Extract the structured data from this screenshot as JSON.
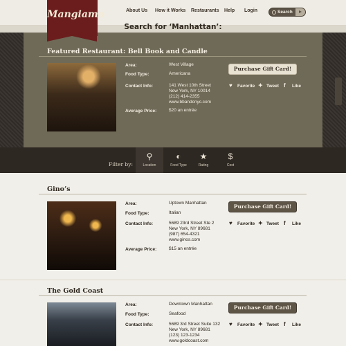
{
  "logo": "Mangiamo",
  "nav": {
    "items": [
      "About Us",
      "How it Works",
      "Restaurants",
      "Help",
      "Login"
    ],
    "search_label": "Search"
  },
  "heading": "Search for ‘Manhattan’:",
  "featured": {
    "title": "Featured Restaurant: Bell Book and Candle",
    "labels": {
      "area": "Area:",
      "food": "Food Type:",
      "contact": "Contact Info:",
      "price": "Average Price:"
    },
    "area": "West Village",
    "food": "Americana",
    "contact": [
      "141 West 10th Street",
      "New York, NY 10014",
      "(212) 414-2355",
      "www.bbandcnyc.com"
    ],
    "price": "$20 an entrée",
    "gift": "Purchase Gift Card!",
    "actions": {
      "favorite": "Favorite",
      "tweet": "Tweet",
      "like": "Like"
    }
  },
  "filter": {
    "label": "Filter by:",
    "options": [
      {
        "label": "Location",
        "icon": "map-pin-icon",
        "glyph": "⚲"
      },
      {
        "label": "Food Type",
        "icon": "globe-icon",
        "glyph": "◐"
      },
      {
        "label": "Rating",
        "icon": "star-icon",
        "glyph": "★"
      },
      {
        "label": "Cost",
        "icon": "dollar-icon",
        "glyph": "$"
      }
    ]
  },
  "restaurants": [
    {
      "title": "Gino’s",
      "area": "Uptown Manhattan",
      "food": "Italian",
      "contact": [
        "5689 23rd Street Ste 2",
        "New York, NY 89681",
        "(987) 654-4321",
        "www.ginos.com"
      ],
      "price": "$15 an entrée",
      "gift": "Purchase Gift Card!",
      "actions": {
        "favorite": "Favorite",
        "tweet": "Tweet",
        "like": "Like"
      }
    },
    {
      "title": "The Gold Coast",
      "area": "Downtown Manhattan",
      "food": "Seafood",
      "contact": [
        "5689 3rd Street Suite 132",
        "New York, NY 89681",
        "(123) 123-1234",
        "www.goldcoast.com"
      ],
      "gift": "Purchase Gift Card!",
      "actions": {
        "favorite": "Favorite",
        "tweet": "Tweet",
        "like": "Like"
      }
    }
  ],
  "list_labels": {
    "area": "Area:",
    "food": "Food Type:",
    "contact": "Contact Info:",
    "price": "Average Price:"
  }
}
